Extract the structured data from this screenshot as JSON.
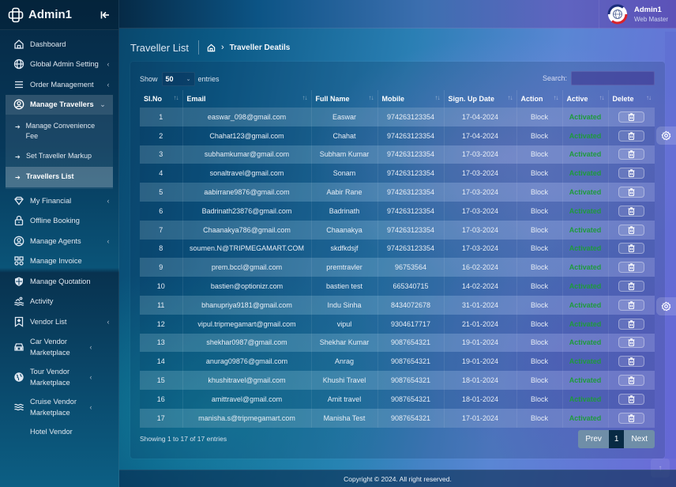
{
  "sidebar": {
    "brand": "Admin1",
    "items": [
      {
        "label": "Dashboard",
        "icon": "home-icon",
        "chevron": ""
      },
      {
        "label": "Global Admin Setting",
        "icon": "globe-icon",
        "chevron": "‹"
      },
      {
        "label": "Order Management",
        "icon": "menu-icon",
        "chevron": "‹"
      },
      {
        "label": "Manage Travellers",
        "icon": "user-circle-icon",
        "chevron": "⌄"
      },
      {
        "label": "My Financial",
        "icon": "diamond-icon",
        "chevron": "‹"
      },
      {
        "label": "Offline Booking",
        "icon": "lock-icon",
        "chevron": ""
      },
      {
        "label": "Manage Agents",
        "icon": "user-circle-icon",
        "chevron": "‹"
      },
      {
        "label": "Manage Invoice",
        "icon": "grid-icon",
        "chevron": ""
      },
      {
        "label": "Manage Quotation",
        "icon": "shield-icon",
        "chevron": ""
      },
      {
        "label": "Activity",
        "icon": "swim-icon",
        "chevron": ""
      },
      {
        "label": "Vendor List",
        "icon": "bookmark-icon",
        "chevron": "‹"
      },
      {
        "label": "Car Vendor Marketplace",
        "icon": "car-icon",
        "chevron": "‹"
      },
      {
        "label": "Tour Vendor Marketplace",
        "icon": "globe-solid-icon",
        "chevron": "‹"
      },
      {
        "label": "Cruise Vendor Marketplace",
        "icon": "waves-icon",
        "chevron": "‹"
      },
      {
        "label": "Hotel Vendor",
        "icon": "",
        "chevron": ""
      }
    ],
    "subitems": [
      {
        "label": "Manage Convenience Fee"
      },
      {
        "label": "Set Traveller Markup"
      },
      {
        "label": "Travellers List"
      }
    ]
  },
  "user": {
    "name": "Admin1",
    "role": "Web Master"
  },
  "page": {
    "title": "Traveller List",
    "breadcrumb_current": "Traveller Deatils"
  },
  "table_controls": {
    "show_label": "Show",
    "page_length": "50",
    "entries_label": "entries",
    "search_label": "Search:",
    "search_value": ""
  },
  "table": {
    "columns": [
      "Sl.No",
      "Email",
      "Full Name",
      "Mobile",
      "Sign. Up Date",
      "Action",
      "Active",
      "Delete"
    ],
    "rows": [
      {
        "sl": "1",
        "email": "easwar_098@gmail.com",
        "name": "Easwar",
        "mobile": "974263123354",
        "date": "17-04-2024",
        "action": "Block",
        "active": "Activated"
      },
      {
        "sl": "2",
        "email": "Chahat123@gmail.com",
        "name": "Chahat",
        "mobile": "974263123354",
        "date": "17-04-2024",
        "action": "Block",
        "active": "Activated"
      },
      {
        "sl": "3",
        "email": "subhamkumar@gmail.com",
        "name": "Subham Kumar",
        "mobile": "974263123354",
        "date": "17-03-2024",
        "action": "Block",
        "active": "Activated"
      },
      {
        "sl": "4",
        "email": "sonaltravel@gmail.com",
        "name": "Sonam",
        "mobile": "974263123354",
        "date": "17-03-2024",
        "action": "Block",
        "active": "Activated"
      },
      {
        "sl": "5",
        "email": "aabirrane9876@gmail.com",
        "name": "Aabir Rane",
        "mobile": "974263123354",
        "date": "17-03-2024",
        "action": "Block",
        "active": "Activated"
      },
      {
        "sl": "6",
        "email": "Badrinath23876@gmail.com",
        "name": "Badrinath",
        "mobile": "974263123354",
        "date": "17-03-2024",
        "action": "Block",
        "active": "Activated"
      },
      {
        "sl": "7",
        "email": "Chaanakya786@gmail.com",
        "name": "Chaanakya",
        "mobile": "974263123354",
        "date": "17-03-2024",
        "action": "Block",
        "active": "Activated"
      },
      {
        "sl": "8",
        "email": "soumen.N@TRIPMEGAMART.COM",
        "name": "skdfkdsjf",
        "mobile": "974263123354",
        "date": "17-03-2024",
        "action": "Block",
        "active": "Activated"
      },
      {
        "sl": "9",
        "email": "prem.bccl@gmail.com",
        "name": "premtravler",
        "mobile": "96753564",
        "date": "16-02-2024",
        "action": "Block",
        "active": "Activated"
      },
      {
        "sl": "10",
        "email": "bastien@optionizr.com",
        "name": "bastien test",
        "mobile": "665340715",
        "date": "14-02-2024",
        "action": "Block",
        "active": "Activated"
      },
      {
        "sl": "11",
        "email": "bhanupriya9181@gmail.com",
        "name": "Indu Sinha",
        "mobile": "8434072678",
        "date": "31-01-2024",
        "action": "Block",
        "active": "Activated"
      },
      {
        "sl": "12",
        "email": "vipul.tripmegamart@gmail.com",
        "name": "vipul",
        "mobile": "9304617717",
        "date": "21-01-2024",
        "action": "Block",
        "active": "Activated"
      },
      {
        "sl": "13",
        "email": "shekhar0987@gmail.com",
        "name": "Shekhar Kumar",
        "mobile": "9087654321",
        "date": "19-01-2024",
        "action": "Block",
        "active": "Activated"
      },
      {
        "sl": "14",
        "email": "anurag09876@gmail.com",
        "name": "Anrag",
        "mobile": "9087654321",
        "date": "19-01-2024",
        "action": "Block",
        "active": "Activated"
      },
      {
        "sl": "15",
        "email": "khushitravel@gmail.com",
        "name": "Khushi Travel",
        "mobile": "9087654321",
        "date": "18-01-2024",
        "action": "Block",
        "active": "Activated"
      },
      {
        "sl": "16",
        "email": "amittravel@gmail.com",
        "name": "Amit travel",
        "mobile": "9087654321",
        "date": "18-01-2024",
        "action": "Block",
        "active": "Activated"
      },
      {
        "sl": "17",
        "email": "manisha.s@tripmegamart.com",
        "name": "Manisha Test",
        "mobile": "9087654321",
        "date": "17-01-2024",
        "action": "Block",
        "active": "Activated"
      }
    ]
  },
  "pagination": {
    "summary": "Showing 1 to 17 of 17 entries",
    "prev": "Prev",
    "current": "1",
    "next": "Next"
  },
  "footer": {
    "copyright": "Copyright © 2024. All right reserved."
  },
  "colors": {
    "activated": "#1e9a3c",
    "pager_button": "#6f8ea8",
    "pager_current": "#082a44"
  }
}
